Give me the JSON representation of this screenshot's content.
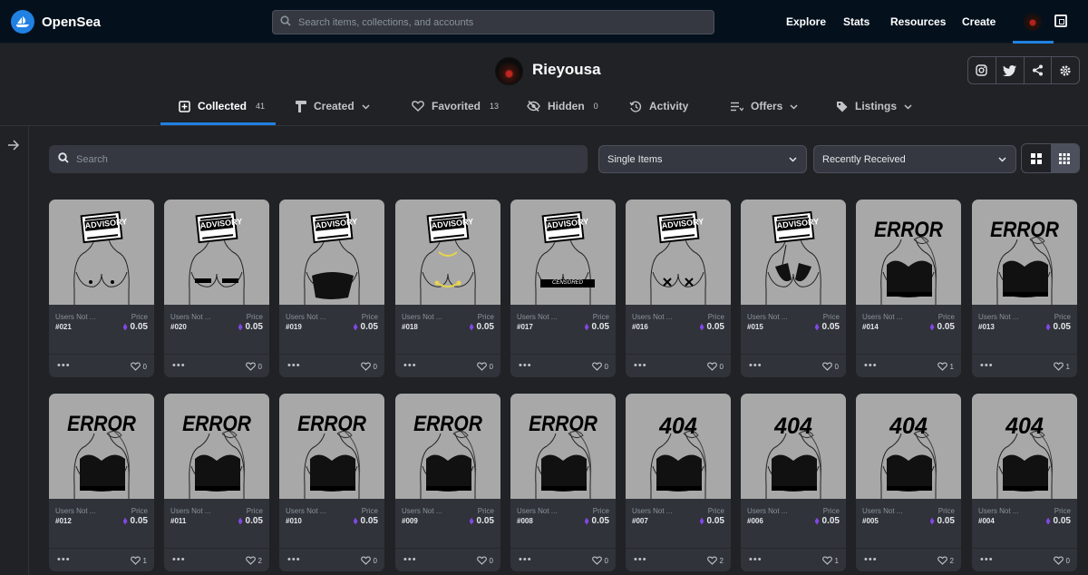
{
  "header": {
    "logo_text": "OpenSea",
    "search_placeholder": "Search items, collections, and accounts",
    "nav": [
      "Explore",
      "Stats",
      "Resources",
      "Create"
    ]
  },
  "profile": {
    "name": "Rieyousa"
  },
  "tabs": [
    {
      "label": "Collected",
      "count": "41",
      "icon": "collected-icon",
      "active": true
    },
    {
      "label": "Created",
      "count": "",
      "icon": "created-icon",
      "dropdown": true
    },
    {
      "label": "Favorited",
      "count": "13",
      "icon": "heart-icon"
    },
    {
      "label": "Hidden",
      "count": "0",
      "icon": "hidden-icon"
    },
    {
      "label": "Activity",
      "count": "",
      "icon": "activity-icon"
    },
    {
      "label": "Offers",
      "count": "",
      "icon": "offers-icon",
      "dropdown": true
    },
    {
      "label": "Listings",
      "count": "",
      "icon": "tag-icon",
      "dropdown": true
    }
  ],
  "filters": {
    "search_placeholder": "Search",
    "item_type": "Single Items",
    "sort": "Recently Received"
  },
  "card_labels": {
    "collection": "Users Not ...",
    "price_label": "Price",
    "more": "•••"
  },
  "items": [
    {
      "name": "#021",
      "price": "0.05",
      "likes": "0",
      "art": "advisory",
      "variant": "nude"
    },
    {
      "name": "#020",
      "price": "0.05",
      "likes": "0",
      "art": "advisory",
      "variant": "bars"
    },
    {
      "name": "#019",
      "price": "0.05",
      "likes": "0",
      "art": "advisory",
      "variant": "underwear"
    },
    {
      "name": "#018",
      "price": "0.05",
      "likes": "0",
      "art": "advisory",
      "variant": "chain"
    },
    {
      "name": "#017",
      "price": "0.05",
      "likes": "0",
      "art": "advisory",
      "variant": "censored"
    },
    {
      "name": "#016",
      "price": "0.05",
      "likes": "0",
      "art": "advisory",
      "variant": "x"
    },
    {
      "name": "#015",
      "price": "0.05",
      "likes": "0",
      "art": "advisory",
      "variant": "bikini"
    },
    {
      "name": "#014",
      "price": "0.05",
      "likes": "1",
      "art": "error",
      "variant": "bra"
    },
    {
      "name": "#013",
      "price": "0.05",
      "likes": "1",
      "art": "error",
      "variant": "bra"
    },
    {
      "name": "#012",
      "price": "0.05",
      "likes": "1",
      "art": "error",
      "variant": "bra"
    },
    {
      "name": "#011",
      "price": "0.05",
      "likes": "2",
      "art": "error",
      "variant": "bra"
    },
    {
      "name": "#010",
      "price": "0.05",
      "likes": "0",
      "art": "error",
      "variant": "bra"
    },
    {
      "name": "#009",
      "price": "0.05",
      "likes": "0",
      "art": "error",
      "variant": "bra"
    },
    {
      "name": "#008",
      "price": "0.05",
      "likes": "0",
      "art": "error",
      "variant": "bra"
    },
    {
      "name": "#007",
      "price": "0.05",
      "likes": "2",
      "art": "404",
      "variant": "bra"
    },
    {
      "name": "#006",
      "price": "0.05",
      "likes": "1",
      "art": "404",
      "variant": "bra"
    },
    {
      "name": "#005",
      "price": "0.05",
      "likes": "2",
      "art": "404",
      "variant": "bra"
    },
    {
      "name": "#004",
      "price": "0.05",
      "likes": "0",
      "art": "404",
      "variant": "bra"
    }
  ],
  "art_text": {
    "advisory": "ADVISORY",
    "error": "ERROR",
    "404": "404",
    "censored": "CENSORED"
  }
}
